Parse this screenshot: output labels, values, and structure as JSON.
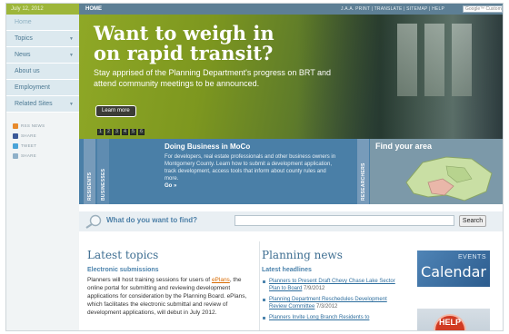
{
  "topbar": {
    "date": "July 12, 2012",
    "home": "HOME",
    "util_links": "J.A.A. PRINT | TRANSLATE | SITEMAP | HELP",
    "search_placeholder": "Google™ Custom Search"
  },
  "sidebar": {
    "items": [
      {
        "label": "Home",
        "has_arrow": false
      },
      {
        "label": "Topics",
        "has_arrow": true
      },
      {
        "label": "News",
        "has_arrow": true
      },
      {
        "label": "About us",
        "has_arrow": false
      },
      {
        "label": "Employment",
        "has_arrow": false
      },
      {
        "label": "Related Sites",
        "has_arrow": true
      }
    ],
    "arrow_glyph": "▼",
    "social": [
      {
        "label": "RSS NEWS",
        "color": "#e78a2c"
      },
      {
        "label": "SHARE",
        "color": "#3b5998"
      },
      {
        "label": "TWEET",
        "color": "#4aa3d8"
      },
      {
        "label": "SHARE",
        "color": "#8fb0c8"
      }
    ]
  },
  "hero": {
    "headline_1": "Want to weigh in",
    "headline_2": "on rapid transit?",
    "body": "Stay apprised of the Planning Department's progress on BRT and attend community meetings to be announced.",
    "button": "Learn more",
    "slides": [
      "1",
      "2",
      "3",
      "4",
      "5",
      "6"
    ]
  },
  "strip": {
    "tabs": [
      "RESIDENTS",
      "BUSINESSES",
      "RESEARCHERS"
    ],
    "heading": "Doing Business in MoCo",
    "body": "For developers, real estate professionals and other business owners in Montgomery County. Learn how to submit a development application, track development, access tools that inform about county rules and more.",
    "goto": "Go »",
    "find_area": "Find your area"
  },
  "search": {
    "question": "What do you want to find?",
    "button": "Search"
  },
  "latest": {
    "title": "Latest topics",
    "subhead": "Electronic submissions",
    "text_before": "Planners will host training sessions for users of ",
    "link": "ePlans",
    "text_after": ", the online portal for submitting and reviewing development applications for consideration by the Planning Board. ePlans, which facilitates the electronic submittal and review of development applications, will debut in July 2012."
  },
  "news": {
    "title": "Planning news",
    "subhead": "Latest headlines",
    "items": [
      {
        "link": "Planners to Present Draft Chevy Chase Lake Sector Plan to Board",
        "date": "7/9/2012"
      },
      {
        "link": "Planning Department Reschedules Development Review Committee",
        "date": "7/3/2012"
      },
      {
        "link": "Planners Invite Long Branch Residents to",
        "date": ""
      }
    ]
  },
  "promos": {
    "events_1": "EVENTS",
    "events_2": "Calendar",
    "help": "HELP"
  }
}
